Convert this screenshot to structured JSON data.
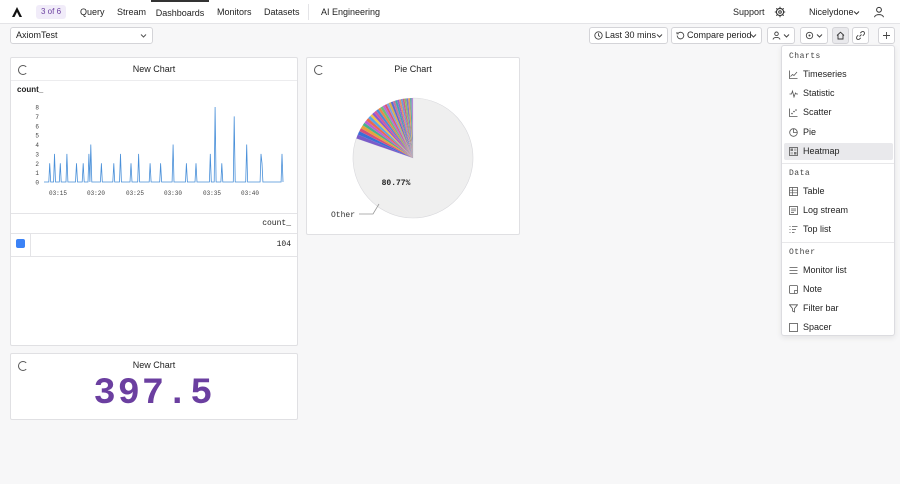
{
  "nav": {
    "counter": "3 of 6",
    "links": [
      "Query",
      "Stream",
      "Dashboards",
      "Monitors",
      "Datasets"
    ],
    "active": "Dashboards",
    "ai_link": "AI Engineering",
    "support": "Support",
    "org": "Nicelydone"
  },
  "toolbar": {
    "dataset": "AxiomTest",
    "time_range": "Last 30 mins",
    "compare": "Compare period"
  },
  "panels": {
    "line": {
      "title": "New Chart",
      "series_label": "count_",
      "table_header": "count_",
      "table_value": "104"
    },
    "pie": {
      "title": "Pie Chart",
      "slice_label": "Other",
      "slice_percent": "80.77%"
    },
    "statistic": {
      "title": "New Chart",
      "value": "397.5"
    }
  },
  "chart_data": [
    {
      "type": "line",
      "title": "New Chart",
      "ylabel": "count_",
      "ylim": [
        0,
        8
      ],
      "yticks": [
        "8",
        "7",
        "6",
        "5",
        "4",
        "3",
        "2",
        "1",
        "0"
      ],
      "xticks": [
        "03:15",
        "03:20",
        "03:25",
        "03:30",
        "03:35",
        "03:40"
      ],
      "series": [
        {
          "name": "count_",
          "values": [
            0,
            0,
            0,
            0,
            0,
            0,
            2,
            0,
            0,
            0,
            0,
            3,
            0,
            0,
            0,
            0,
            0,
            2,
            0,
            0,
            0,
            0,
            0,
            0,
            3,
            0,
            0,
            0,
            0,
            0,
            0,
            0,
            0,
            0,
            2,
            0,
            0,
            0,
            0,
            0,
            0,
            2,
            0,
            0,
            0,
            0,
            0,
            3,
            0,
            4,
            0,
            0,
            0,
            0,
            0,
            0,
            0,
            0,
            0,
            0,
            2,
            0,
            0,
            0,
            0,
            0,
            0,
            0,
            0,
            0,
            0,
            0,
            0,
            2,
            0,
            0,
            0,
            0,
            0,
            0,
            3,
            0,
            0,
            0,
            0,
            0,
            0,
            0,
            0,
            0,
            0,
            2,
            0,
            0,
            0,
            0,
            0,
            0,
            0,
            3,
            0,
            0,
            0,
            0,
            0,
            0,
            0,
            0,
            0,
            0,
            0,
            2,
            0,
            0,
            0,
            0,
            0,
            0,
            0,
            0,
            0,
            0,
            2,
            0,
            0,
            0,
            0,
            0,
            0,
            0,
            0,
            0,
            0,
            0,
            0,
            4,
            0,
            0,
            0,
            0,
            0,
            0,
            0,
            0,
            0,
            0,
            0,
            0,
            0,
            2,
            0,
            0,
            0,
            0,
            0,
            0,
            0,
            0,
            0,
            2,
            0,
            0,
            0,
            0,
            0,
            0,
            0,
            0,
            0,
            0,
            0,
            0,
            0,
            0,
            3,
            0,
            0,
            0,
            0,
            8,
            0,
            0,
            0,
            0,
            0,
            0,
            2,
            0,
            0,
            0,
            0,
            0,
            0,
            0,
            0,
            0,
            0,
            0,
            0,
            7,
            0,
            0,
            0,
            0,
            0,
            0,
            0,
            0,
            0,
            0,
            0,
            0,
            4,
            0,
            0,
            0,
            0,
            0,
            0,
            0,
            0,
            0,
            0,
            0,
            0,
            0,
            0,
            3,
            2,
            0,
            0,
            0,
            0,
            0,
            0,
            0,
            0,
            0,
            0,
            0,
            0,
            0,
            0,
            0,
            0,
            0,
            0,
            0,
            0,
            3,
            0
          ]
        }
      ]
    },
    {
      "type": "pie",
      "title": "Pie Chart",
      "slices": [
        {
          "label": "Other",
          "value": 80.77,
          "color": "#efefef"
        },
        {
          "label": "",
          "value": 1.1,
          "color": "#7a5bc9"
        },
        {
          "label": "",
          "value": 1.0,
          "color": "#3b6fd6"
        },
        {
          "label": "",
          "value": 0.9,
          "color": "#d94f7a"
        },
        {
          "label": "",
          "value": 0.9,
          "color": "#e8a33b"
        },
        {
          "label": "",
          "value": 0.8,
          "color": "#4bb08c"
        },
        {
          "label": "",
          "value": 0.8,
          "color": "#c05fd0"
        },
        {
          "label": "",
          "value": 0.8,
          "color": "#e86a50"
        },
        {
          "label": "",
          "value": 0.8,
          "color": "#5aa3e8"
        },
        {
          "label": "",
          "value": 0.7,
          "color": "#f0c24a"
        },
        {
          "label": "",
          "value": 0.7,
          "color": "#8a5ad0"
        },
        {
          "label": "",
          "value": 0.7,
          "color": "#d45a9c"
        },
        {
          "label": "",
          "value": 0.7,
          "color": "#4c8ad9"
        },
        {
          "label": "",
          "value": 0.7,
          "color": "#e7884a"
        },
        {
          "label": "",
          "value": 0.7,
          "color": "#6bbf7a"
        },
        {
          "label": "",
          "value": 0.6,
          "color": "#b56ad6"
        },
        {
          "label": "",
          "value": 0.6,
          "color": "#e05570"
        },
        {
          "label": "",
          "value": 0.6,
          "color": "#7f9fe0"
        },
        {
          "label": "",
          "value": 0.6,
          "color": "#d8b04a"
        },
        {
          "label": "",
          "value": 0.6,
          "color": "#5c6bd0"
        },
        {
          "label": "",
          "value": 0.6,
          "color": "#c8739c"
        },
        {
          "label": "",
          "value": 0.6,
          "color": "#46a5b0"
        },
        {
          "label": "",
          "value": 0.5,
          "color": "#9a62c8"
        },
        {
          "label": "",
          "value": 0.5,
          "color": "#e49060"
        },
        {
          "label": "",
          "value": 0.5,
          "color": "#6a9ed8"
        },
        {
          "label": "",
          "value": 0.5,
          "color": "#d06088"
        },
        {
          "label": "",
          "value": 0.5,
          "color": "#8bbf6a"
        },
        {
          "label": "",
          "value": 0.5,
          "color": "#7a7ad0"
        },
        {
          "label": "",
          "value": 0.5,
          "color": "#e0a060"
        },
        {
          "label": "",
          "value": 0.4,
          "color": "#58a8a0"
        },
        {
          "label": "",
          "value": 0.4,
          "color": "#b888d8"
        }
      ]
    },
    {
      "type": "table",
      "title": "New Chart",
      "value": "397.5"
    }
  ],
  "menu": {
    "sections": [
      {
        "title": "Charts",
        "items": [
          {
            "label": "Timeseries",
            "icon": "timeseries-icon"
          },
          {
            "label": "Statistic",
            "icon": "statistic-icon"
          },
          {
            "label": "Scatter",
            "icon": "scatter-icon"
          },
          {
            "label": "Pie",
            "icon": "pie-icon"
          },
          {
            "label": "Heatmap",
            "icon": "heatmap-icon"
          }
        ]
      },
      {
        "title": "Data",
        "items": [
          {
            "label": "Table",
            "icon": "table-icon"
          },
          {
            "label": "Log stream",
            "icon": "log-stream-icon"
          },
          {
            "label": "Top list",
            "icon": "top-list-icon"
          }
        ]
      },
      {
        "title": "Other",
        "items": [
          {
            "label": "Monitor list",
            "icon": "monitor-list-icon"
          },
          {
            "label": "Note",
            "icon": "note-icon"
          },
          {
            "label": "Filter bar",
            "icon": "filter-bar-icon"
          },
          {
            "label": "Spacer",
            "icon": "spacer-icon"
          }
        ]
      }
    ],
    "highlighted": "Heatmap"
  },
  "colors": {
    "accent": "#6b3fa0",
    "line": "#4a90d9",
    "checkbox": "#3b82f6",
    "statistic": "#6b3fa0"
  }
}
